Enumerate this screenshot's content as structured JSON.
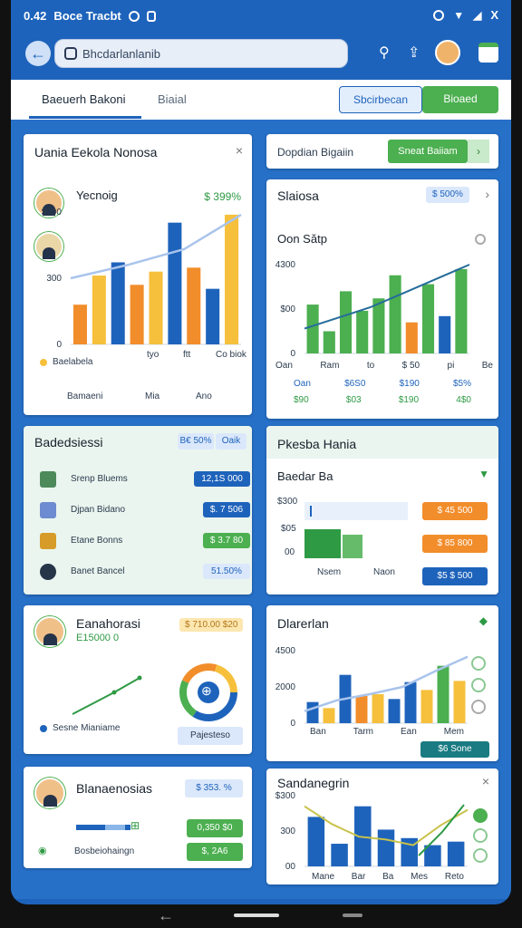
{
  "status": {
    "time": "0.42",
    "app": "Boce Tracbt",
    "right_label": "X"
  },
  "search": {
    "placeholder": "Bhcdarlanlanib"
  },
  "tabs": [
    {
      "label": "Baeuerh Bakoni"
    },
    {
      "label": "Biaial"
    }
  ],
  "tab_buttons": {
    "b1": "Sbcirbecan",
    "b2": "Bioaed"
  },
  "colors": {
    "primary": "#1e63bb",
    "green": "#4caf50",
    "orange": "#f28d2b",
    "yellow": "#f6c03c"
  },
  "card1": {
    "title": "Uania Eekola Nonosa",
    "person": "Yecnoig",
    "value": "$ 399%",
    "legend": "Baelabela",
    "footer": [
      "Bamaeni",
      "Mia",
      "Ano"
    ],
    "yticks": [
      "$000",
      "300",
      "0"
    ],
    "xlabels": [
      "tyo",
      "ftt",
      "Co biok"
    ]
  },
  "chart1_data": {
    "type": "bar",
    "values": [
      30,
      52,
      62,
      45,
      55,
      92,
      58,
      42,
      98
    ],
    "colors": [
      "orange",
      "yellow",
      "blue",
      "orange",
      "yellow",
      "blue",
      "orange",
      "blue",
      "yellow"
    ],
    "line": [
      50,
      60,
      72,
      98
    ],
    "ylim": [
      0,
      100
    ]
  },
  "card2": {
    "label": "Dopdian Bigaiin",
    "button": "Sneat Baiiam"
  },
  "card3": {
    "title": "Slaiosa",
    "badge": "$ 500%",
    "subtitle": "Oon Sătp",
    "yticks": [
      "4300",
      "$00",
      "0"
    ],
    "legend": [
      "Oan",
      "Ram",
      "to",
      "$ 50",
      "pi",
      "Be"
    ],
    "row1": [
      "Oan",
      "$6S0",
      "$190",
      "$5%"
    ],
    "row2": [
      "$90",
      "$03",
      "$190",
      "4$0"
    ]
  },
  "chart3_data": {
    "type": "bar",
    "values": [
      55,
      25,
      70,
      48,
      62,
      88,
      35,
      78,
      42,
      95
    ],
    "colors": [
      "green",
      "green",
      "green",
      "green",
      "green",
      "green",
      "orange",
      "green",
      "blue",
      "green"
    ],
    "line": [
      28,
      40,
      52,
      68,
      84,
      100
    ],
    "ylim": [
      0,
      100
    ]
  },
  "card4": {
    "title": "Badedsiessi",
    "badge1": "B€ 50%",
    "badge2": "Oaik",
    "rows": [
      {
        "label": "Srenp Bluems",
        "value": "12,1S 000"
      },
      {
        "label": "Djpan Bidano",
        "value": "$. 7 506"
      },
      {
        "label": "Etane Bonns",
        "value": "$ 3.7 80"
      },
      {
        "label": "Banet Bancel",
        "value": "51.50%"
      }
    ]
  },
  "card5": {
    "title": "Pkesba Hania",
    "sub": "Baedar Ba",
    "yticks": [
      "$300",
      "$05",
      "00"
    ],
    "xlabels": [
      "Nsem",
      "Naon"
    ],
    "badges": [
      "$ 45 500",
      "$ 85 800",
      "$5 $ 500"
    ]
  },
  "card6": {
    "title": "Eanahorasi",
    "sub": "E15000 0",
    "badge": "$ 710.00 $20",
    "legend": "Sesne Mianiame",
    "button": "Pajesteso"
  },
  "card7": {
    "title": "Dlarerlan",
    "yticks": [
      "4500",
      "2000",
      "0"
    ],
    "xlabels": [
      "Ban",
      "Tarm",
      "Ean",
      "Mem"
    ],
    "button": "$6 Sone"
  },
  "chart7_data": {
    "type": "bar",
    "values": [
      35,
      25,
      80,
      45,
      48,
      40,
      68,
      55,
      95,
      70
    ],
    "colors": [
      "blue",
      "yellow",
      "blue",
      "orange",
      "yellow",
      "blue",
      "blue",
      "yellow",
      "green",
      "yellow"
    ],
    "line": [
      20,
      38,
      48,
      60,
      86,
      110
    ],
    "ylim": [
      0,
      120
    ]
  },
  "card8": {
    "title": "Blanaenosias",
    "badge": "$ 353. %",
    "badge1": "0,350 $0",
    "badge2": "$, 2A6",
    "legend": "Bosbeiohaingn"
  },
  "card9": {
    "title": "Sandanegrin",
    "yticks": [
      "$300",
      "300",
      "00"
    ],
    "xlabels": [
      "Mane",
      "Bar",
      "Ba",
      "Mes",
      "Reto"
    ]
  },
  "chart9_data": {
    "type": "bar",
    "values": [
      70,
      32,
      85,
      52,
      40,
      30,
      35
    ],
    "colors": [
      "blue",
      "blue",
      "blue",
      "blue",
      "blue",
      "blue",
      "blue"
    ],
    "line": [
      85,
      60,
      42,
      38,
      30,
      58,
      80
    ],
    "ylim": [
      0,
      100
    ]
  }
}
